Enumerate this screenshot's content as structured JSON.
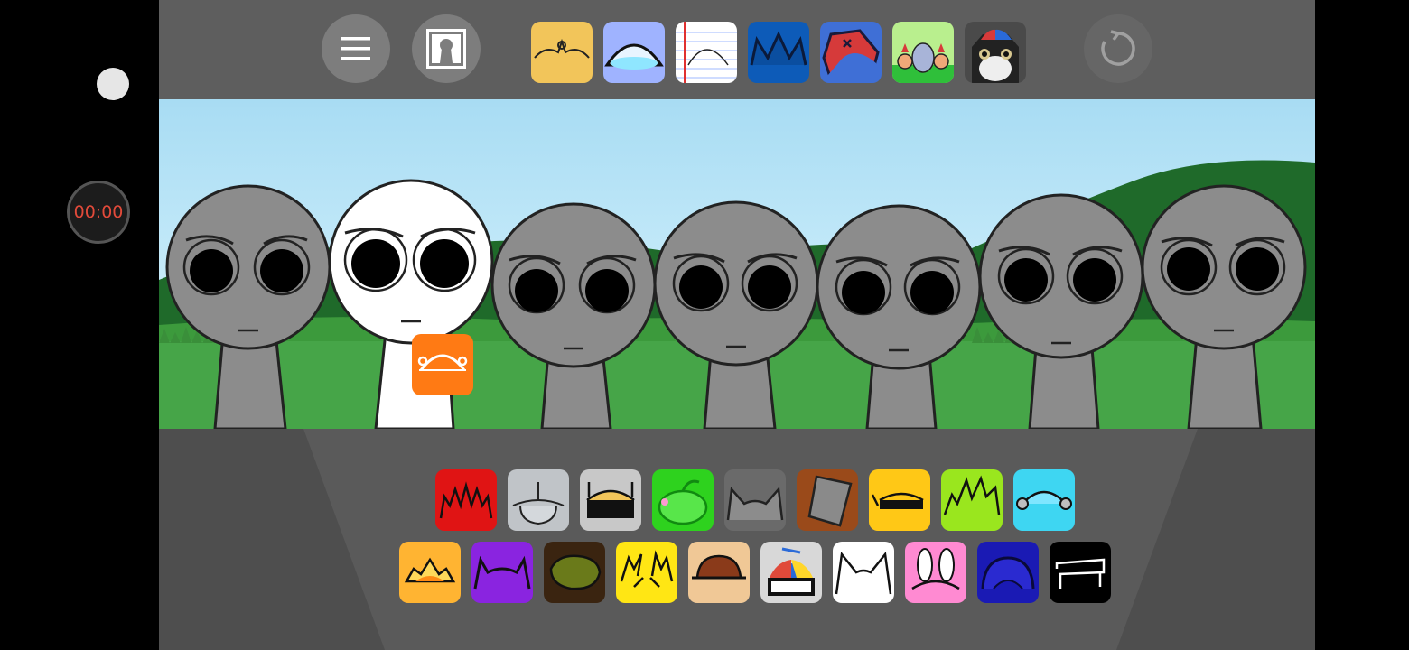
{
  "timer": {
    "text": "00:00"
  },
  "colors": {
    "background": "#000000",
    "topbar": "#5e5e5e",
    "floor": "#5a5a5a",
    "character_gray": "#8c8c8c",
    "character_active": "#ffffff",
    "timer_text": "#e14a3a"
  },
  "toolbar": {
    "menu_icon": "hamburger-menu-icon",
    "scene_icon": "keyhole-door-icon",
    "reset_icon": "reset-refresh-icon"
  },
  "themes": [
    {
      "name": "theme-yellow",
      "color": "#f2c55a"
    },
    {
      "name": "theme-periwinkle",
      "color": "#9fb3ff"
    },
    {
      "name": "theme-notebook",
      "color": "#ffffff"
    },
    {
      "name": "theme-blue-crown",
      "color": "#0d5bb8"
    },
    {
      "name": "theme-blue-red",
      "color": "#3f6fd6"
    },
    {
      "name": "theme-garden",
      "color": "#7fd36b"
    },
    {
      "name": "theme-cat",
      "color": "#444444"
    }
  ],
  "characters": [
    {
      "name": "character-1",
      "state": "empty"
    },
    {
      "name": "character-2",
      "state": "active"
    },
    {
      "name": "character-3",
      "state": "empty"
    },
    {
      "name": "character-4",
      "state": "empty"
    },
    {
      "name": "character-5",
      "state": "empty"
    },
    {
      "name": "character-6",
      "state": "empty"
    },
    {
      "name": "character-7",
      "state": "empty"
    }
  ],
  "palette_row1": [
    {
      "name": "sound-red-spikes",
      "color": "#e01414"
    },
    {
      "name": "sound-silver-hat",
      "color": "#c0c4c8"
    },
    {
      "name": "sound-antenna-visor",
      "color": "#c8c8c8"
    },
    {
      "name": "sound-green-fruit",
      "color": "#2ed21e"
    },
    {
      "name": "sound-gray-cat-ears",
      "color": "#6a6a6a"
    },
    {
      "name": "sound-bucket",
      "color": "#9a4a1a"
    },
    {
      "name": "sound-yellow-headphone",
      "color": "#ffc816"
    },
    {
      "name": "sound-lime-spikes",
      "color": "#9ae61e"
    },
    {
      "name": "sound-cyan-headset",
      "color": "#3ed6f2"
    }
  ],
  "palette_row2": [
    {
      "name": "sound-orange-sun",
      "color": "#ffb432"
    },
    {
      "name": "sound-purple-horns",
      "color": "#8a24e0"
    },
    {
      "name": "sound-olive-hair",
      "color": "#3a2410"
    },
    {
      "name": "sound-yellow-sparks",
      "color": "#ffe614"
    },
    {
      "name": "sound-brown-cap",
      "color": "#f0c896"
    },
    {
      "name": "sound-propeller-cap",
      "color": "#d8d8d8"
    },
    {
      "name": "sound-white-cat-ears",
      "color": "#ffffff"
    },
    {
      "name": "sound-pink-bunny",
      "color": "#ff8ad2"
    },
    {
      "name": "sound-navy-helmet",
      "color": "#1a1ab4"
    },
    {
      "name": "sound-black-frame",
      "color": "#000000"
    }
  ]
}
